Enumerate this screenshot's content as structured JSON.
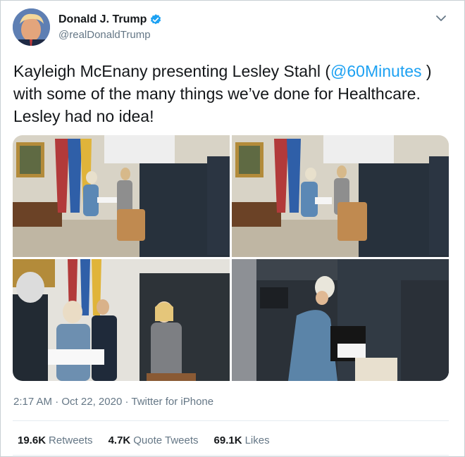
{
  "author": {
    "display_name": "Donald J. Trump",
    "handle": "@realDonaldTrump",
    "avatar_icon": "avatar-photo",
    "verified_icon": "verified-badge-icon",
    "verified_color": "#1da1f2"
  },
  "tweet": {
    "text_before": "Kayleigh McEnany presenting Lesley Stahl (",
    "mention": "@60Minutes",
    "text_after": " ) with some of the many things we’ve done for Healthcare. Lesley had no idea!",
    "mention_color": "#1da1f2"
  },
  "media": {
    "photos": [
      {
        "name": "photo-1"
      },
      {
        "name": "photo-2"
      },
      {
        "name": "photo-3"
      },
      {
        "name": "photo-4"
      }
    ]
  },
  "meta": {
    "time": "2:17 AM",
    "date": "Oct 22, 2020",
    "source": "Twitter for iPhone",
    "separator": "·"
  },
  "stats": {
    "retweets_count": "19.6K",
    "retweets_label": "Retweets",
    "quotes_count": "4.7K",
    "quotes_label": "Quote Tweets",
    "likes_count": "69.1K",
    "likes_label": "Likes"
  }
}
